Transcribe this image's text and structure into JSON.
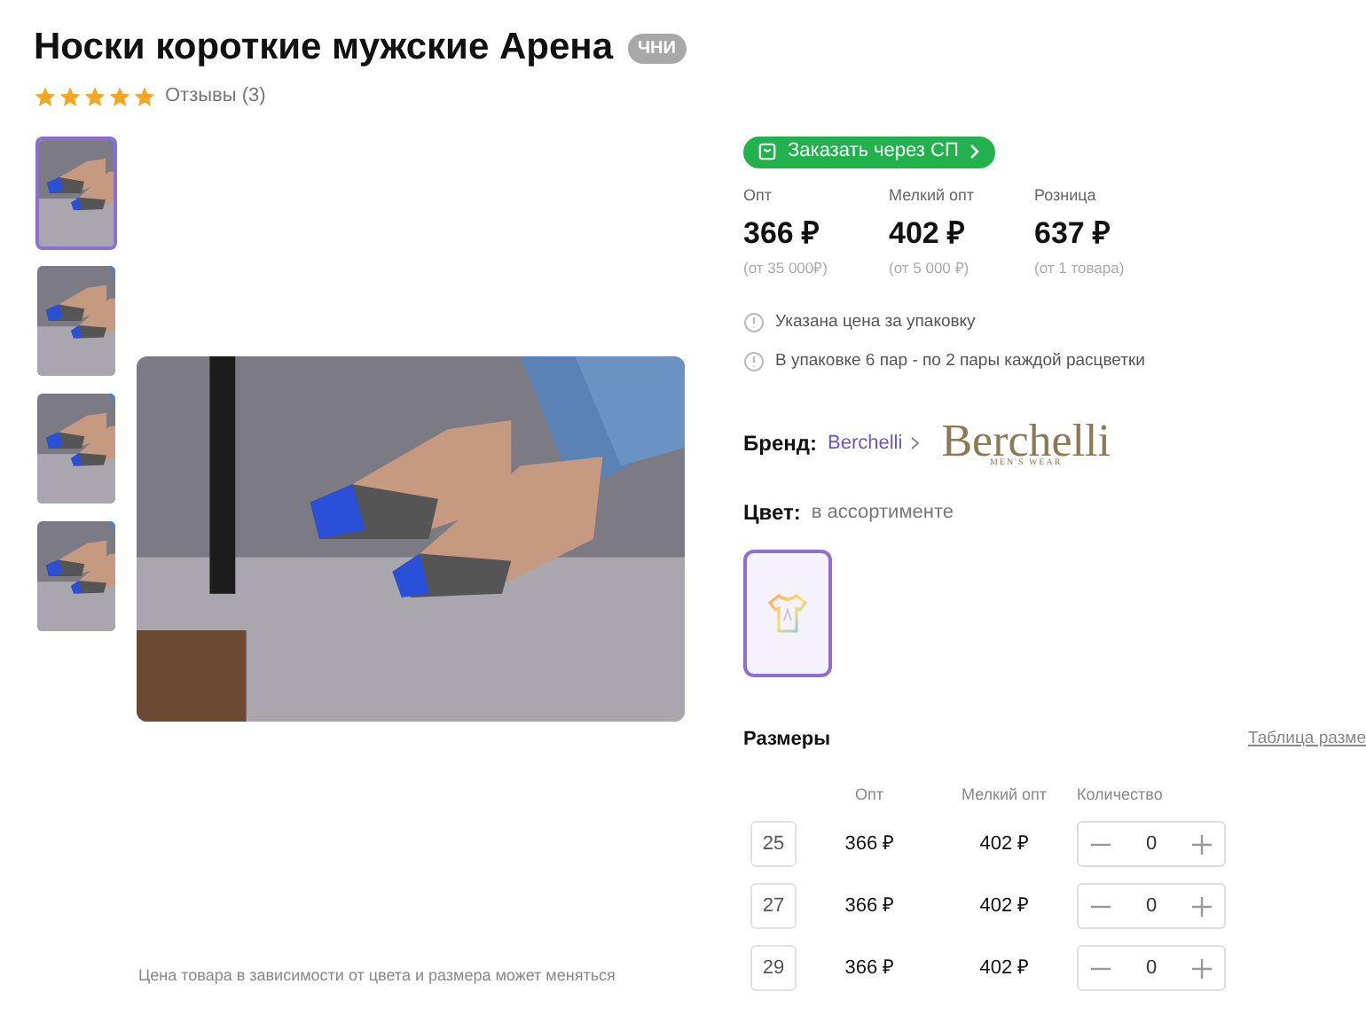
{
  "title": "Носки короткие мужские Арена",
  "badge": "ЧНИ",
  "rating": {
    "stars": 5,
    "reviews": "Отзывы (3)"
  },
  "thumbnails": [
    {
      "selected": true
    },
    {
      "selected": false
    },
    {
      "selected": false
    },
    {
      "selected": false
    }
  ],
  "photo_caption": "Цена товара в зависимости от цвета и размера может меняться",
  "order_button": "Заказать через СП",
  "prices": [
    {
      "label": "Опт",
      "value": "366 ₽",
      "note": "(от 35 000₽)"
    },
    {
      "label": "Мелкий опт",
      "value": "402 ₽",
      "note": "(от 5 000 ₽)"
    },
    {
      "label": "Розница",
      "value": "637 ₽",
      "note": "(от 1 товара)"
    }
  ],
  "notes": [
    "Указана цена за упаковку",
    "В упаковке 6 пар - по 2 пары каждой расцветки"
  ],
  "brand": {
    "label": "Бренд:",
    "name": "Berchelli",
    "logo": "Berchelli",
    "logo_sub": "MEN'S WEAR"
  },
  "color": {
    "label": "Цвет:",
    "value": "в ассортименте",
    "swatch_selected": true
  },
  "sizes": {
    "title": "Размеры",
    "link": "Таблица разме",
    "columns": [
      "Опт",
      "Мелкий опт",
      "Количество"
    ],
    "rows": [
      {
        "size": "25",
        "opt": "366 ₽",
        "small_opt": "402 ₽",
        "qty": "0"
      },
      {
        "size": "27",
        "opt": "366 ₽",
        "small_opt": "402 ₽",
        "qty": "0"
      },
      {
        "size": "29",
        "opt": "366 ₽",
        "small_opt": "402 ₽",
        "qty": "0"
      }
    ]
  }
}
